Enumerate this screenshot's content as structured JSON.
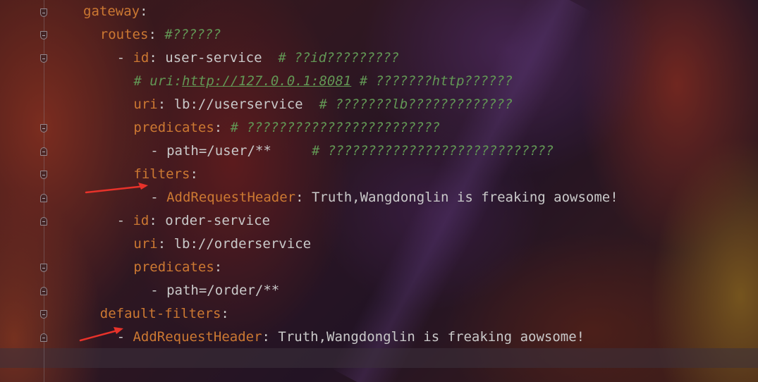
{
  "editor": {
    "language": "yaml",
    "lines": [
      {
        "indent": "",
        "parts": [
          {
            "t": "gateway",
            "c": "key"
          },
          {
            "t": ":",
            "c": "txt"
          }
        ]
      },
      {
        "indent": "  ",
        "parts": [
          {
            "t": "routes",
            "c": "key"
          },
          {
            "t": ": ",
            "c": "txt"
          },
          {
            "t": "#??????",
            "c": "cmt"
          }
        ]
      },
      {
        "indent": "    ",
        "parts": [
          {
            "t": "- ",
            "c": "txt"
          },
          {
            "t": "id",
            "c": "key"
          },
          {
            "t": ": user-service  ",
            "c": "txt"
          },
          {
            "t": "# ??id?????????",
            "c": "cmt"
          }
        ]
      },
      {
        "indent": "      ",
        "parts": [
          {
            "t": "# uri:",
            "c": "cmt"
          },
          {
            "t": "http://127.0.0.1:8081",
            "c": "link"
          },
          {
            "t": " # ???????http??????",
            "c": "cmt"
          }
        ]
      },
      {
        "indent": "      ",
        "parts": [
          {
            "t": "uri",
            "c": "key"
          },
          {
            "t": ": lb://userservice  ",
            "c": "txt"
          },
          {
            "t": "# ???????lb?????????????",
            "c": "cmt"
          }
        ]
      },
      {
        "indent": "      ",
        "parts": [
          {
            "t": "predicates",
            "c": "key"
          },
          {
            "t": ": ",
            "c": "txt"
          },
          {
            "t": "# ????????????????????????",
            "c": "cmt"
          }
        ]
      },
      {
        "indent": "        ",
        "parts": [
          {
            "t": "- path=/user/**     ",
            "c": "txt"
          },
          {
            "t": "# ????????????????????????????",
            "c": "cmt"
          }
        ]
      },
      {
        "indent": "      ",
        "parts": [
          {
            "t": "filters",
            "c": "key"
          },
          {
            "t": ":",
            "c": "txt"
          }
        ]
      },
      {
        "indent": "        ",
        "parts": [
          {
            "t": "- ",
            "c": "txt"
          },
          {
            "t": "AddRequestHeader",
            "c": "key"
          },
          {
            "t": ": Truth,Wangdonglin is freaking aowsome!",
            "c": "txt"
          }
        ]
      },
      {
        "indent": "    ",
        "parts": [
          {
            "t": "- ",
            "c": "txt"
          },
          {
            "t": "id",
            "c": "key"
          },
          {
            "t": ": order-service",
            "c": "txt"
          }
        ]
      },
      {
        "indent": "      ",
        "parts": [
          {
            "t": "uri",
            "c": "key"
          },
          {
            "t": ": lb://orderservice",
            "c": "txt"
          }
        ]
      },
      {
        "indent": "      ",
        "parts": [
          {
            "t": "predicates",
            "c": "key"
          },
          {
            "t": ":",
            "c": "txt"
          }
        ]
      },
      {
        "indent": "        ",
        "parts": [
          {
            "t": "- path=/order/**",
            "c": "txt"
          }
        ]
      },
      {
        "indent": "  ",
        "parts": [
          {
            "t": "default-filters",
            "c": "key"
          },
          {
            "t": ":",
            "c": "txt"
          }
        ]
      },
      {
        "indent": "    ",
        "parts": [
          {
            "t": "- ",
            "c": "txt"
          },
          {
            "t": "AddRequestHeader",
            "c": "key"
          },
          {
            "t": ": Truth,Wangdonglin is freaking aowsome!",
            "c": "txt"
          }
        ]
      },
      {
        "indent": "",
        "parts": []
      }
    ]
  },
  "annotations": [
    {
      "name": "red-arrow-filters",
      "color": "#e8322a"
    },
    {
      "name": "red-arrow-default-filters",
      "color": "#e8322a"
    }
  ],
  "colors": {
    "key": "#cc7832",
    "text": "#c9c9c9",
    "comment": "#629755"
  }
}
